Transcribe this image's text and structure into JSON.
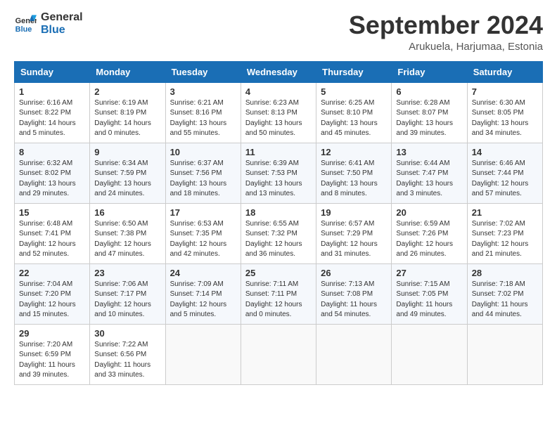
{
  "header": {
    "logo_line1": "General",
    "logo_line2": "Blue",
    "month_title": "September 2024",
    "subtitle": "Arukuela, Harjumaa, Estonia"
  },
  "columns": [
    "Sunday",
    "Monday",
    "Tuesday",
    "Wednesday",
    "Thursday",
    "Friday",
    "Saturday"
  ],
  "weeks": [
    [
      {
        "day": "1",
        "sunrise": "Sunrise: 6:16 AM",
        "sunset": "Sunset: 8:22 PM",
        "daylight": "Daylight: 14 hours and 5 minutes."
      },
      {
        "day": "2",
        "sunrise": "Sunrise: 6:19 AM",
        "sunset": "Sunset: 8:19 PM",
        "daylight": "Daylight: 14 hours and 0 minutes."
      },
      {
        "day": "3",
        "sunrise": "Sunrise: 6:21 AM",
        "sunset": "Sunset: 8:16 PM",
        "daylight": "Daylight: 13 hours and 55 minutes."
      },
      {
        "day": "4",
        "sunrise": "Sunrise: 6:23 AM",
        "sunset": "Sunset: 8:13 PM",
        "daylight": "Daylight: 13 hours and 50 minutes."
      },
      {
        "day": "5",
        "sunrise": "Sunrise: 6:25 AM",
        "sunset": "Sunset: 8:10 PM",
        "daylight": "Daylight: 13 hours and 45 minutes."
      },
      {
        "day": "6",
        "sunrise": "Sunrise: 6:28 AM",
        "sunset": "Sunset: 8:07 PM",
        "daylight": "Daylight: 13 hours and 39 minutes."
      },
      {
        "day": "7",
        "sunrise": "Sunrise: 6:30 AM",
        "sunset": "Sunset: 8:05 PM",
        "daylight": "Daylight: 13 hours and 34 minutes."
      }
    ],
    [
      {
        "day": "8",
        "sunrise": "Sunrise: 6:32 AM",
        "sunset": "Sunset: 8:02 PM",
        "daylight": "Daylight: 13 hours and 29 minutes."
      },
      {
        "day": "9",
        "sunrise": "Sunrise: 6:34 AM",
        "sunset": "Sunset: 7:59 PM",
        "daylight": "Daylight: 13 hours and 24 minutes."
      },
      {
        "day": "10",
        "sunrise": "Sunrise: 6:37 AM",
        "sunset": "Sunset: 7:56 PM",
        "daylight": "Daylight: 13 hours and 18 minutes."
      },
      {
        "day": "11",
        "sunrise": "Sunrise: 6:39 AM",
        "sunset": "Sunset: 7:53 PM",
        "daylight": "Daylight: 13 hours and 13 minutes."
      },
      {
        "day": "12",
        "sunrise": "Sunrise: 6:41 AM",
        "sunset": "Sunset: 7:50 PM",
        "daylight": "Daylight: 13 hours and 8 minutes."
      },
      {
        "day": "13",
        "sunrise": "Sunrise: 6:44 AM",
        "sunset": "Sunset: 7:47 PM",
        "daylight": "Daylight: 13 hours and 3 minutes."
      },
      {
        "day": "14",
        "sunrise": "Sunrise: 6:46 AM",
        "sunset": "Sunset: 7:44 PM",
        "daylight": "Daylight: 12 hours and 57 minutes."
      }
    ],
    [
      {
        "day": "15",
        "sunrise": "Sunrise: 6:48 AM",
        "sunset": "Sunset: 7:41 PM",
        "daylight": "Daylight: 12 hours and 52 minutes."
      },
      {
        "day": "16",
        "sunrise": "Sunrise: 6:50 AM",
        "sunset": "Sunset: 7:38 PM",
        "daylight": "Daylight: 12 hours and 47 minutes."
      },
      {
        "day": "17",
        "sunrise": "Sunrise: 6:53 AM",
        "sunset": "Sunset: 7:35 PM",
        "daylight": "Daylight: 12 hours and 42 minutes."
      },
      {
        "day": "18",
        "sunrise": "Sunrise: 6:55 AM",
        "sunset": "Sunset: 7:32 PM",
        "daylight": "Daylight: 12 hours and 36 minutes."
      },
      {
        "day": "19",
        "sunrise": "Sunrise: 6:57 AM",
        "sunset": "Sunset: 7:29 PM",
        "daylight": "Daylight: 12 hours and 31 minutes."
      },
      {
        "day": "20",
        "sunrise": "Sunrise: 6:59 AM",
        "sunset": "Sunset: 7:26 PM",
        "daylight": "Daylight: 12 hours and 26 minutes."
      },
      {
        "day": "21",
        "sunrise": "Sunrise: 7:02 AM",
        "sunset": "Sunset: 7:23 PM",
        "daylight": "Daylight: 12 hours and 21 minutes."
      }
    ],
    [
      {
        "day": "22",
        "sunrise": "Sunrise: 7:04 AM",
        "sunset": "Sunset: 7:20 PM",
        "daylight": "Daylight: 12 hours and 15 minutes."
      },
      {
        "day": "23",
        "sunrise": "Sunrise: 7:06 AM",
        "sunset": "Sunset: 7:17 PM",
        "daylight": "Daylight: 12 hours and 10 minutes."
      },
      {
        "day": "24",
        "sunrise": "Sunrise: 7:09 AM",
        "sunset": "Sunset: 7:14 PM",
        "daylight": "Daylight: 12 hours and 5 minutes."
      },
      {
        "day": "25",
        "sunrise": "Sunrise: 7:11 AM",
        "sunset": "Sunset: 7:11 PM",
        "daylight": "Daylight: 12 hours and 0 minutes."
      },
      {
        "day": "26",
        "sunrise": "Sunrise: 7:13 AM",
        "sunset": "Sunset: 7:08 PM",
        "daylight": "Daylight: 11 hours and 54 minutes."
      },
      {
        "day": "27",
        "sunrise": "Sunrise: 7:15 AM",
        "sunset": "Sunset: 7:05 PM",
        "daylight": "Daylight: 11 hours and 49 minutes."
      },
      {
        "day": "28",
        "sunrise": "Sunrise: 7:18 AM",
        "sunset": "Sunset: 7:02 PM",
        "daylight": "Daylight: 11 hours and 44 minutes."
      }
    ],
    [
      {
        "day": "29",
        "sunrise": "Sunrise: 7:20 AM",
        "sunset": "Sunset: 6:59 PM",
        "daylight": "Daylight: 11 hours and 39 minutes."
      },
      {
        "day": "30",
        "sunrise": "Sunrise: 7:22 AM",
        "sunset": "Sunset: 6:56 PM",
        "daylight": "Daylight: 11 hours and 33 minutes."
      },
      null,
      null,
      null,
      null,
      null
    ]
  ]
}
